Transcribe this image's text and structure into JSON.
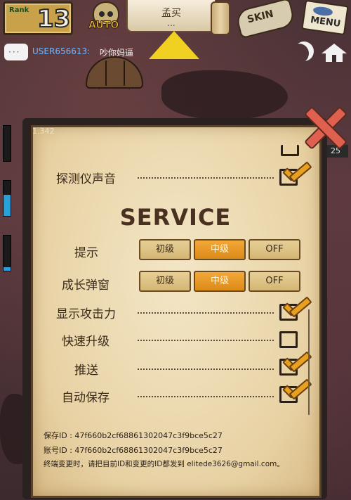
{
  "hud": {
    "rank_label": "Rank",
    "rank_value": "13",
    "auto_label": "AUTO",
    "buy_label": "孟买",
    "buy_dots": "...",
    "skin_label": "SKIN",
    "menu_label": "MENU"
  },
  "chat": {
    "username": "USER656613:",
    "message": "吵你妈逼"
  },
  "panel": {
    "version": "1.342",
    "partial_label": "",
    "detector_sound_label": "探测仪声音",
    "detector_sound_checked": true,
    "service_title": "SERVICE",
    "hint_label": "提示",
    "hint_options": [
      "初级",
      "中级",
      "OFF"
    ],
    "hint_selected": "中级",
    "growth_popup_label": "成长弹窗",
    "growth_options": [
      "初级",
      "中级",
      "OFF"
    ],
    "growth_selected": "中级",
    "show_attack_label": "显示攻击力",
    "show_attack_checked": true,
    "fast_upgrade_label": "快速升级",
    "fast_upgrade_checked": false,
    "push_label": "推送",
    "push_checked": true,
    "autosave_label": "自动保存",
    "autosave_checked": true,
    "save_id": "保存ID : 47f660b2cf68861302047c3f9bce5c27",
    "account_id": "账号ID : 47f660b2cf68861302047c3f9bce5c27",
    "footer_note": "终端变更时，请把目前ID和变更的ID都发到 elitede3626@gmail.com。"
  },
  "side": {
    "badge": "25",
    "bar_levels": [
      0.0,
      0.6,
      0.1
    ]
  },
  "colors": {
    "accent": "#e8a020",
    "active_segment": "#dc8a18",
    "chat_user": "#6fb6ff",
    "close_x": "#e0604f"
  }
}
